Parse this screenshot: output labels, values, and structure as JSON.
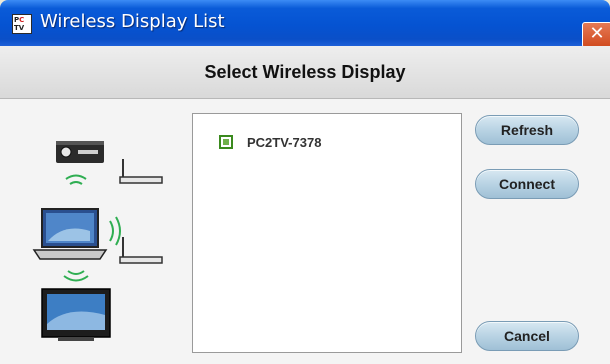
{
  "window": {
    "title": "Wireless Display List",
    "icon": "pc2tv-app-icon",
    "close_label": "✕"
  },
  "header": {
    "title": "Select Wireless Display"
  },
  "display_list": {
    "items": [
      {
        "label": "PC2TV-7378"
      }
    ]
  },
  "buttons": {
    "refresh": "Refresh",
    "connect": "Connect",
    "cancel": "Cancel"
  },
  "diagram": {
    "icons": [
      "projector-icon",
      "access-point-icon",
      "laptop-icon",
      "tv-icon"
    ]
  },
  "colors": {
    "titlebar": "#0553d2",
    "close_button": "#d04a1e",
    "list_marker": "#3b8a1e",
    "button": "#b9d3e4"
  }
}
